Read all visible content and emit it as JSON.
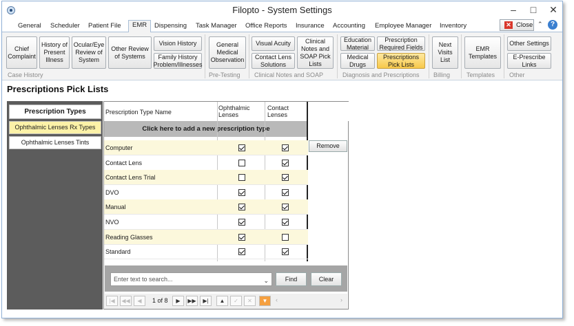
{
  "window": {
    "title": "Filopto - System Settings"
  },
  "tabs": [
    "General",
    "Scheduler",
    "Patient File",
    "EMR",
    "Dispensing",
    "Task Manager",
    "Office Reports",
    "Insurance",
    "Accounting",
    "Employee Manager",
    "Inventory"
  ],
  "close_label": "Close",
  "ribbon": {
    "case_history": {
      "label": "Case History",
      "buttons": [
        "Chief Complaint",
        "History of Present Illness",
        "Ocular/Eye Review of System",
        "Other Review of Systems",
        "Vision History",
        "Family History Problem/Illnesses"
      ]
    },
    "pre_testing": {
      "label": "Pre-Testing",
      "buttons": [
        "General Medical Observation"
      ]
    },
    "clinical_notes": {
      "label": "Clinical Notes and SOAP",
      "buttons": [
        "Visual Acuity",
        "Contact Lens Solutions",
        "Clinical Notes and SOAP Pick Lists"
      ]
    },
    "diagnosis": {
      "label": "Diagnosis and Prescriptions",
      "buttons": [
        "Education Material",
        "Prescription Required Fields",
        "Medical Drugs",
        "Prescriptions Pick Lists"
      ]
    },
    "billing": {
      "label": "Billing",
      "buttons": [
        "Next Visits List"
      ]
    },
    "templates": {
      "label": "Templates",
      "buttons": [
        "EMR Templates"
      ]
    },
    "other": {
      "label": "Other",
      "buttons": [
        "Other Settings",
        "E-Prescribe Links"
      ]
    }
  },
  "page_title": "Prescriptions Pick Lists",
  "sidebar": {
    "header": "Prescription Types",
    "items": [
      "Ophthalmic Lenses Rx Types",
      "Ophthalmic Lenses Tints"
    ]
  },
  "grid": {
    "columns": [
      "Prescription Type Name",
      "Ophthalmic Lenses",
      "Contact Lenses"
    ],
    "add_row": "Click here to add a new prescription type",
    "remove_label": "Remove",
    "rows": [
      {
        "name": "Computer",
        "ophthalmic": true,
        "contact": true
      },
      {
        "name": "Contact Lens",
        "ophthalmic": false,
        "contact": true
      },
      {
        "name": "Contact Lens Trial",
        "ophthalmic": false,
        "contact": true
      },
      {
        "name": "DVO",
        "ophthalmic": true,
        "contact": true
      },
      {
        "name": "Manual",
        "ophthalmic": true,
        "contact": true
      },
      {
        "name": "NVO",
        "ophthalmic": true,
        "contact": true
      },
      {
        "name": "Reading Glasses",
        "ophthalmic": true,
        "contact": false
      },
      {
        "name": "Standard",
        "ophthalmic": true,
        "contact": true
      }
    ]
  },
  "search": {
    "placeholder": "Enter text to search...",
    "find_label": "Find",
    "clear_label": "Clear"
  },
  "pager": {
    "text": "1 of 8"
  },
  "icons": {
    "close": "close-icon",
    "help": "help-icon",
    "app": "app-icon"
  },
  "colors": {
    "accent": "#3a7fd0",
    "selected": "#fcf2a8",
    "highlight": "#f7c84a",
    "close": "#d9372b"
  }
}
